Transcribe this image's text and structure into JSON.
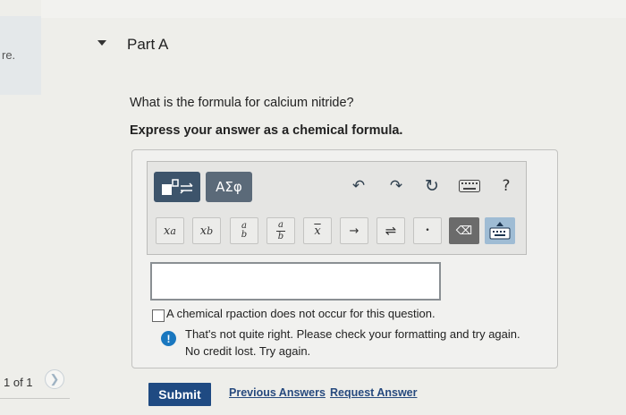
{
  "sidebar": {
    "snippet": "re.",
    "page_counter": "1 of 1",
    "next_icon": "chevron-right-icon"
  },
  "part": {
    "title": "Part A",
    "question": "What is the formula for calcium nitride?",
    "instruction": "Express your answer as a chemical formula."
  },
  "toolbar": {
    "greek_label": "ΑΣφ",
    "undo_glyph": "↶",
    "redo_glyph": "↷",
    "reset_glyph": "↻",
    "help_label": "?",
    "symbols": {
      "superscript_base": "x",
      "superscript_exp": "a",
      "subscript_base": "x",
      "subscript_sub": "b",
      "frac_num": "a",
      "frac_den": "b",
      "inline_frac_num": "a",
      "inline_frac_den": "b",
      "overline": "x",
      "arrow": "→",
      "equilibrium": "⇌",
      "dot": "•",
      "delete_glyph": "⌫"
    }
  },
  "answer": {
    "value": "",
    "no_reaction_label": "A chemical rpaction does not occur for this question."
  },
  "feedback": {
    "icon": "!",
    "line1": "That's not quite right. Please check your formatting and try again.",
    "line2": "No credit lost. Try again."
  },
  "actions": {
    "submit_label": "Submit",
    "previous_answers_label": "Previous Answers",
    "request_answer_label": "Request Answer"
  },
  "colors": {
    "submit_bg": "#1f4a82",
    "alert_blue": "#1977bf",
    "template_btn": "#3d546b"
  }
}
